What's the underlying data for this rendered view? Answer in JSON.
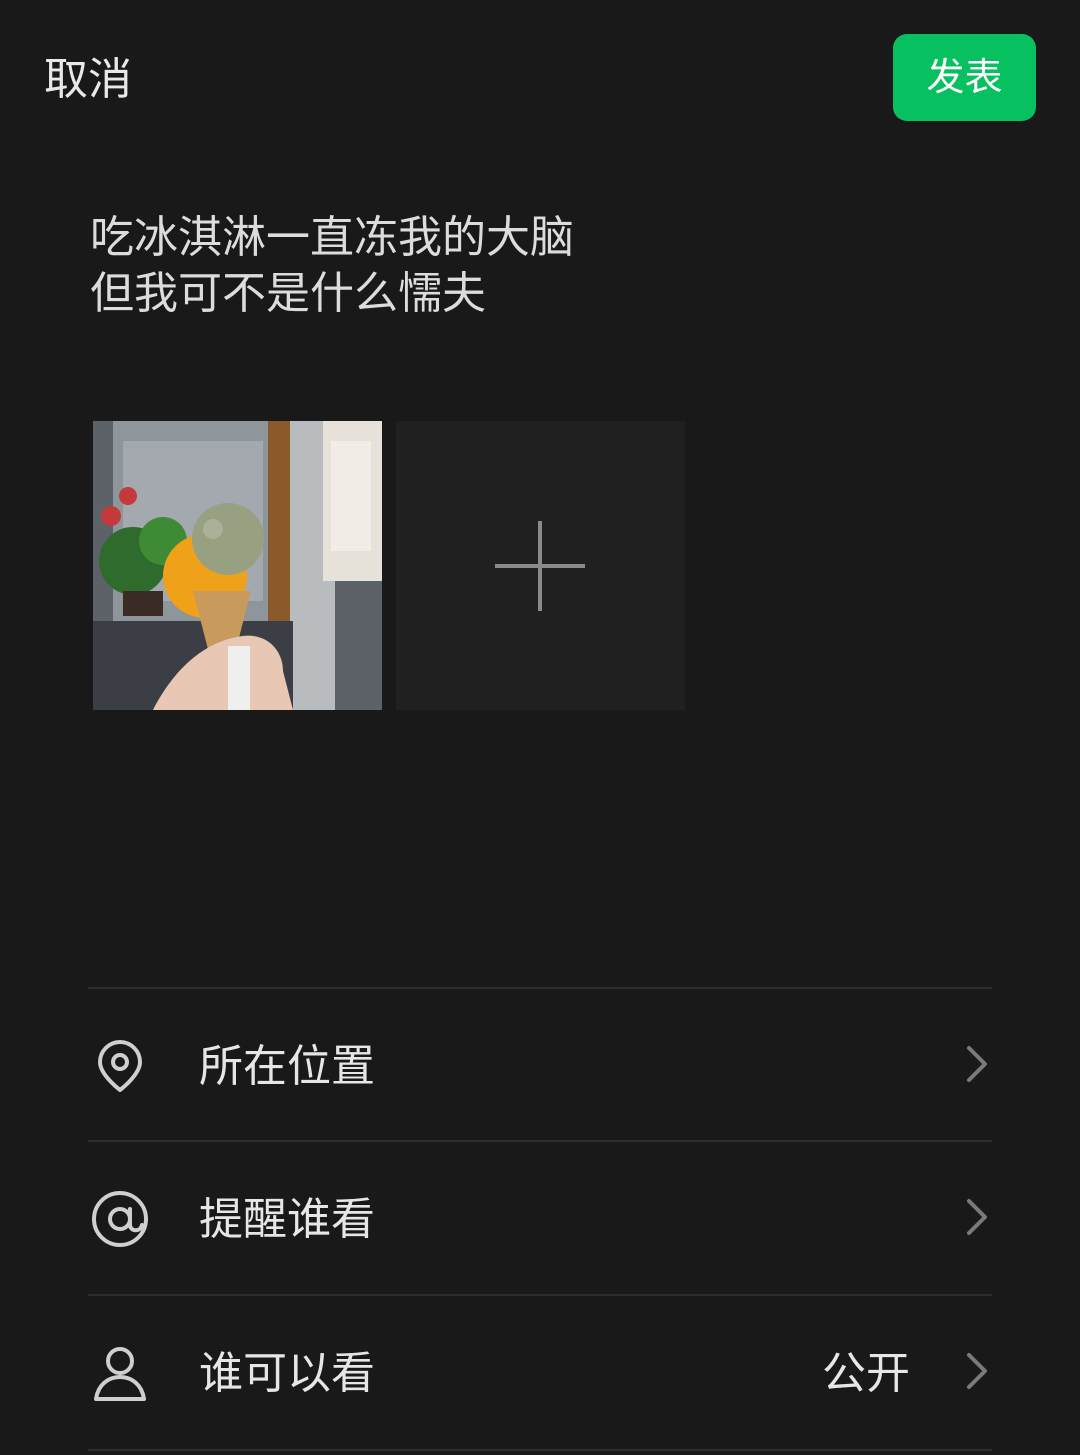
{
  "header": {
    "cancel_label": "取消",
    "publish_label": "发表"
  },
  "post": {
    "text_lines": [
      "吃冰淇淋一直冻我的大脑",
      "但我可不是什么懦夫"
    ]
  },
  "media": {
    "photo_icon": "ice-cream-photo",
    "add_icon": "plus-icon"
  },
  "options": [
    {
      "icon": "location-pin-icon",
      "label": "所在位置",
      "value": ""
    },
    {
      "icon": "at-sign-icon",
      "label": "提醒谁看",
      "value": ""
    },
    {
      "icon": "person-icon",
      "label": "谁可以看",
      "value": "公开"
    }
  ],
  "colors": {
    "background": "#191919",
    "accent": "#07c160",
    "text": "#e6e6e6",
    "divider": "#2c2c2c",
    "icon": "#8a8a8a"
  }
}
